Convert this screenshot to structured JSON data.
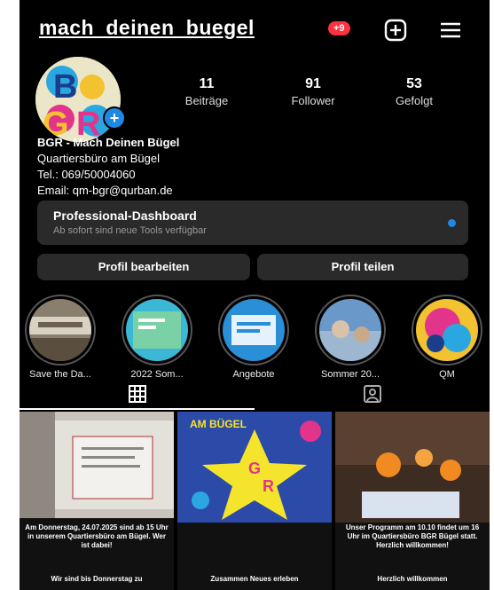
{
  "profile": {
    "username": "mach_deinen_buegel",
    "notification_badge": "+9",
    "stats": [
      {
        "value": "11",
        "label": "Beiträge"
      },
      {
        "value": "91",
        "label": "Follower"
      },
      {
        "value": "53",
        "label": "Gefolgt"
      }
    ],
    "bio": {
      "name": "BGR - Mach Deinen Bügel",
      "line1": "Quartiersbüro am Bügel",
      "line2": "Tel.: 069/50004060",
      "line3": "Email: qm-bgr@qurban.de"
    },
    "avatar_text": "BGR"
  },
  "dashboard": {
    "title": "Professional-Dashboard",
    "subtitle": "Ab sofort sind neue Tools verfügbar"
  },
  "buttons": {
    "edit": "Profil bearbeiten",
    "share": "Profil teilen"
  },
  "highlights": [
    {
      "label": "Save the Da..."
    },
    {
      "label": "2022 Som..."
    },
    {
      "label": "Angebote"
    },
    {
      "label": "Sommer 20..."
    },
    {
      "label": "QM"
    }
  ],
  "posts": [
    {
      "caption_top": "Am Donnerstag, 24.07.2025 sind ab 15 Uhr in unserem Quartiersbüro am Bügel. Wer ist dabei!",
      "caption_bottom": "Wir sind bis Donnerstag zu"
    },
    {
      "image_text": "AM BÜGEL",
      "caption_bottom": "Zusammen Neues erleben"
    },
    {
      "caption_top": "Unser Programm am 10.10 findet um 16 Uhr im Quartiersbüro BGR Bügel statt. Herzlich willkommen!",
      "caption_bottom": "Herzlich willkommen"
    }
  ],
  "colors": {
    "background": "#000000",
    "accent_blue": "#1e88e5",
    "badge_red": "#ff3040",
    "button_bg": "#2a2a2a"
  },
  "icons": [
    "plus-square-icon",
    "menu-icon",
    "grid-icon",
    "tagged-icon"
  ]
}
